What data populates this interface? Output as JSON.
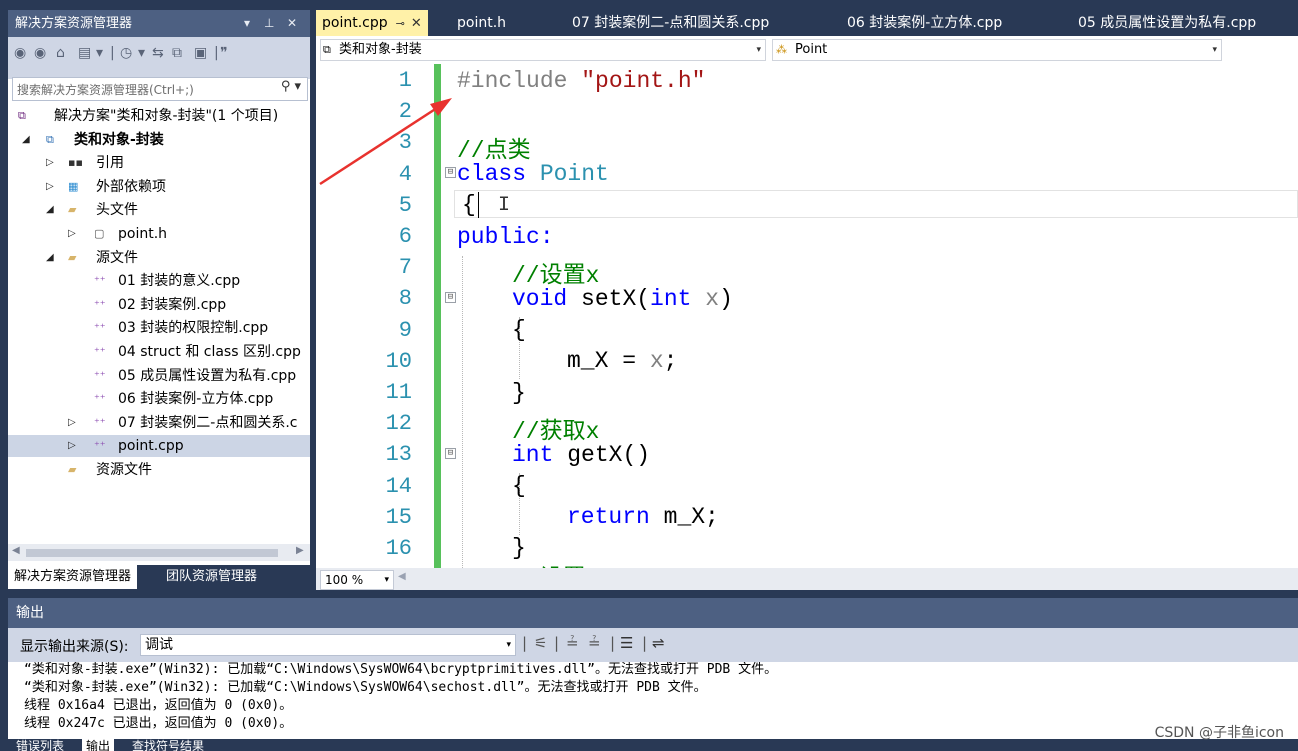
{
  "solution_explorer": {
    "title": "解决方案资源管理器",
    "title_controls": [
      "▾",
      "ᵖ",
      "✕"
    ],
    "search_placeholder": "搜索解决方案资源管理器(Ctrl+;)",
    "tree": [
      {
        "label": "解决方案\"类和对象-封装\"(1 个项目)",
        "icon": "solution-icon",
        "arrow": ""
      },
      {
        "label": "类和对象-封装",
        "icon": "project-icon",
        "arrow": "◢"
      },
      {
        "label": "引用",
        "icon": "references-icon",
        "arrow": "▷"
      },
      {
        "label": "外部依赖项",
        "icon": "external-deps-icon",
        "arrow": "▷"
      },
      {
        "label": "头文件",
        "icon": "folder-icon",
        "arrow": "◢"
      },
      {
        "label": "point.h",
        "icon": "header-file-icon",
        "arrow": "▷"
      },
      {
        "label": "源文件",
        "icon": "folder-icon",
        "arrow": "◢"
      },
      {
        "label": "01 封装的意义.cpp",
        "icon": "cpp-file-icon",
        "arrow": ""
      },
      {
        "label": "02 封装案例.cpp",
        "icon": "cpp-file-icon",
        "arrow": ""
      },
      {
        "label": "03 封装的权限控制.cpp",
        "icon": "cpp-file-icon",
        "arrow": ""
      },
      {
        "label": "04 struct 和 class 区别.cpp",
        "icon": "cpp-file-icon",
        "arrow": ""
      },
      {
        "label": "05 成员属性设置为私有.cpp",
        "icon": "cpp-file-icon",
        "arrow": ""
      },
      {
        "label": "06 封装案例-立方体.cpp",
        "icon": "cpp-file-icon",
        "arrow": ""
      },
      {
        "label": "07 封装案例二-点和圆关系.c",
        "icon": "cpp-file-icon",
        "arrow": "▷"
      },
      {
        "label": "point.cpp",
        "icon": "cpp-file-icon",
        "arrow": "▷"
      },
      {
        "label": "资源文件",
        "icon": "folder-icon",
        "arrow": ""
      }
    ],
    "bottom_tabs": [
      "解决方案资源管理器",
      "团队资源管理器"
    ]
  },
  "editor": {
    "tabs": [
      {
        "label": "point.cpp",
        "active": true
      },
      {
        "label": "point.h"
      },
      {
        "label": "07 封装案例二-点和圆关系.cpp"
      },
      {
        "label": "06 封装案例-立方体.cpp"
      },
      {
        "label": "05 成员属性设置为私有.cpp"
      }
    ],
    "nav_scope": "类和对象-封装",
    "nav_member": "Point",
    "zoom": "100 %",
    "line_numbers": [
      "1",
      "2",
      "3",
      "4",
      "5",
      "6",
      "7",
      "8",
      "9",
      "10",
      "11",
      "12",
      "13",
      "14",
      "15",
      "16"
    ],
    "code": {
      "l1_pp": "#include",
      "l1_str": "\"point.h\"",
      "l3": "//点类",
      "l4_kw": "class",
      "l4_ty": "Point",
      "l5": "{",
      "l6": "public:",
      "l7": "//设置x",
      "l8_kw": "void",
      "l8_fn": "setX(",
      "l8_kw2": "int",
      "l8_param": "x",
      "l8_end": ")",
      "l9": "{",
      "l10_a": "m_X = ",
      "l10_param": "x",
      "l10_b": ";",
      "l11": "}",
      "l12": "//获取x",
      "l13_kw": "int",
      "l13_fn": "getX()",
      "l14": "{",
      "l15_kw": "return",
      "l15_rest": "m_X;",
      "l16": "}",
      "l17_partial": "//设置"
    }
  },
  "output": {
    "title": "输出",
    "source_label": "显示输出来源(S):",
    "source_value": "调试",
    "lines": [
      "“类和对象-封装.exe”(Win32): 已加载“C:\\Windows\\SysWOW64\\bcryptprimitives.dll”。无法查找或打开 PDB 文件。",
      "“类和对象-封装.exe”(Win32): 已加载“C:\\Windows\\SysWOW64\\sechost.dll”。无法查找或打开 PDB 文件。",
      "线程 0x16a4 已退出，返回值为 0 (0x0)。",
      "线程 0x247c 已退出，返回值为 0 (0x0)。"
    ],
    "bottom_tabs": [
      "错误列表",
      "输出",
      "查找符号结果"
    ]
  },
  "watermark": "CSDN @子非鱼icon",
  "colors": {
    "chrome": "#293955",
    "panel_title": "#4d6082",
    "active_tab": "#fff1a8",
    "change_bar": "#57c15b",
    "annotation_arrow": "#e8322e"
  }
}
